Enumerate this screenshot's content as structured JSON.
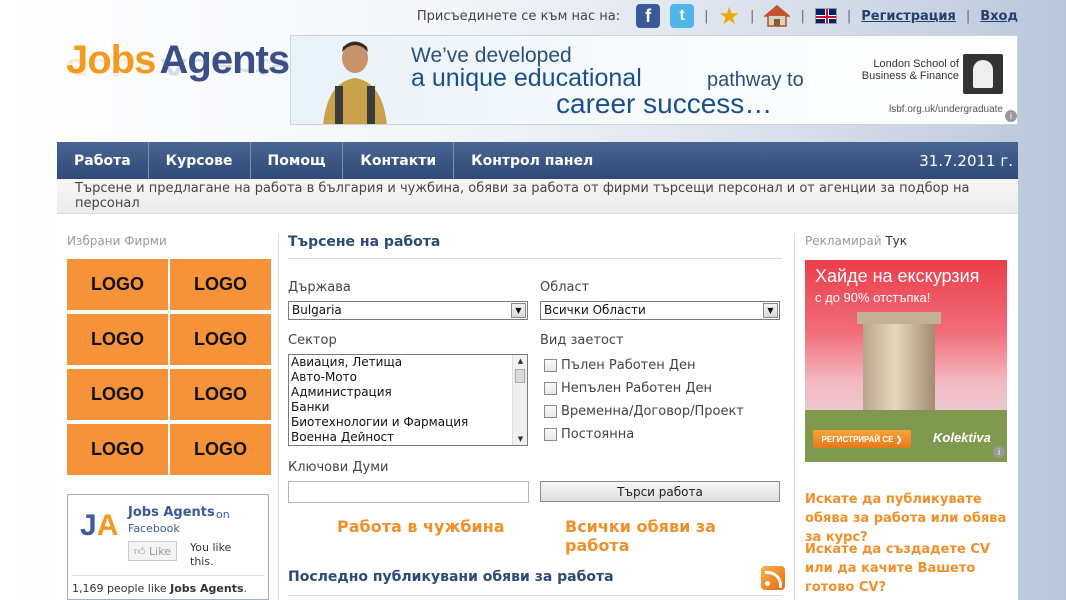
{
  "topbar": {
    "join_text": "Присъединете се към нас на:",
    "separator": "|",
    "register": "Регистрация",
    "login": "Вход",
    "icons": [
      "facebook-icon",
      "twitter-icon",
      "star-icon",
      "home-icon",
      "uk-flag-icon"
    ]
  },
  "logo": {
    "part1": "Jobs",
    "part2": "Agents"
  },
  "banner": {
    "line1": "We’ve developed",
    "line2": "a unique educational",
    "line2b": "pathway to",
    "line3": "career success…",
    "school": "London School of Business & Finance",
    "url": "lsbf.org.uk/undergraduate",
    "info": "i"
  },
  "nav": {
    "items": [
      "Работа",
      "Курсове",
      "Помощ",
      "Контакти",
      "Контрол панел"
    ],
    "date": "31.7.2011 г."
  },
  "tagline": "Търсене и предлагане на работа в българия и чужбина, обяви за работа от фирми търсещи персонал и от агенции за подбор на персонал",
  "left": {
    "title": "Избрани Фирми",
    "logos": [
      "LOGO",
      "LOGO",
      "LOGO",
      "LOGO",
      "LOGO",
      "LOGO",
      "LOGO",
      "LOGO"
    ],
    "facebook": {
      "page_name": "Jobs Agents",
      "on": "on",
      "site": "Facebook",
      "like_button": "Like",
      "you_like": "You like this.",
      "count_prefix": "1,169 people like ",
      "count_name": "Jobs Agents",
      "count_suffix": "."
    }
  },
  "search": {
    "title": "Търсене на работа",
    "country_label": "Държава",
    "country_value": "Bulgaria",
    "region_label": "Област",
    "region_value": "Всички Области",
    "sector_label": "Сектор",
    "sectors": [
      "Авиация, Летища",
      "Авто-Мото",
      "Администрация",
      "Банки",
      "Биотехнологии и Фармация",
      "Военна Дейност"
    ],
    "employment_label": "Вид заетост",
    "employment": [
      "Пълен Работен Ден",
      "Непълен Работен Ден",
      "Временна/Договор/Проект",
      "Постоянна"
    ],
    "keywords_label": "Ключови Думи",
    "keywords_value": "",
    "search_button": "Търси работа",
    "link_abroad": "Работа в чужбина",
    "link_all": "Всички обяви за работа",
    "latest_title": "Последно публикувани обяви за работа"
  },
  "right": {
    "title_prefix": "Рекламирай",
    "title_link": "Тук",
    "ad": {
      "headline": "Хайде на екскурзия",
      "sub": "с до 90% отстъпка!",
      "button": "РЕГИСТРИРАЙ СЕ",
      "brand": "Kolektiva",
      "info": "i"
    },
    "promo1": "Искате да публикувате обява за работа или обява за курс?",
    "promo2": "Искате да създадете CV или да качите Вашето готово CV?"
  },
  "colors": {
    "nav_bg": "#2f4a77",
    "accent_orange": "#f0902a",
    "logo_tile": "#f6923a",
    "heading_blue": "#2c4a78"
  }
}
